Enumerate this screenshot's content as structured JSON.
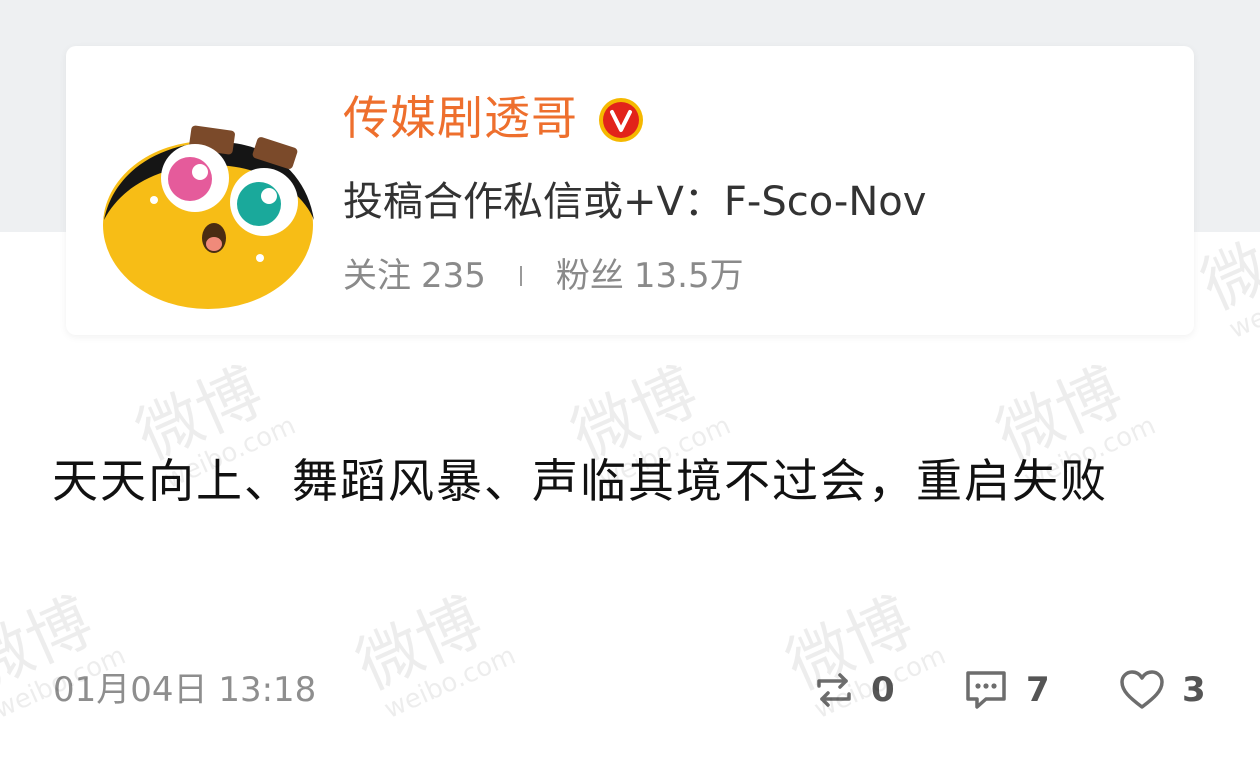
{
  "profile": {
    "name": "传媒剧透哥",
    "bio": "投稿合作私信或+V：F-Sco-Nov",
    "following_label": "关注",
    "following_count": "235",
    "followers_label": "粉丝",
    "followers_count": "13.5万",
    "avatar_icon": "cartoon-face-avatar",
    "verified_icon": "verified-badge-icon"
  },
  "post": {
    "text": "天天向上、舞蹈风暴、声临其境不过会，重启失败",
    "time": "01月04日 13:18"
  },
  "actions": {
    "repost_count": "0",
    "comment_count": "7",
    "like_count": "3"
  },
  "watermark": {
    "text": "微博",
    "subtext": "weibo.com"
  },
  "colors": {
    "name": "#ee6f2d",
    "verified_badge": "#e2231a",
    "page_band": "#eef0f2"
  }
}
